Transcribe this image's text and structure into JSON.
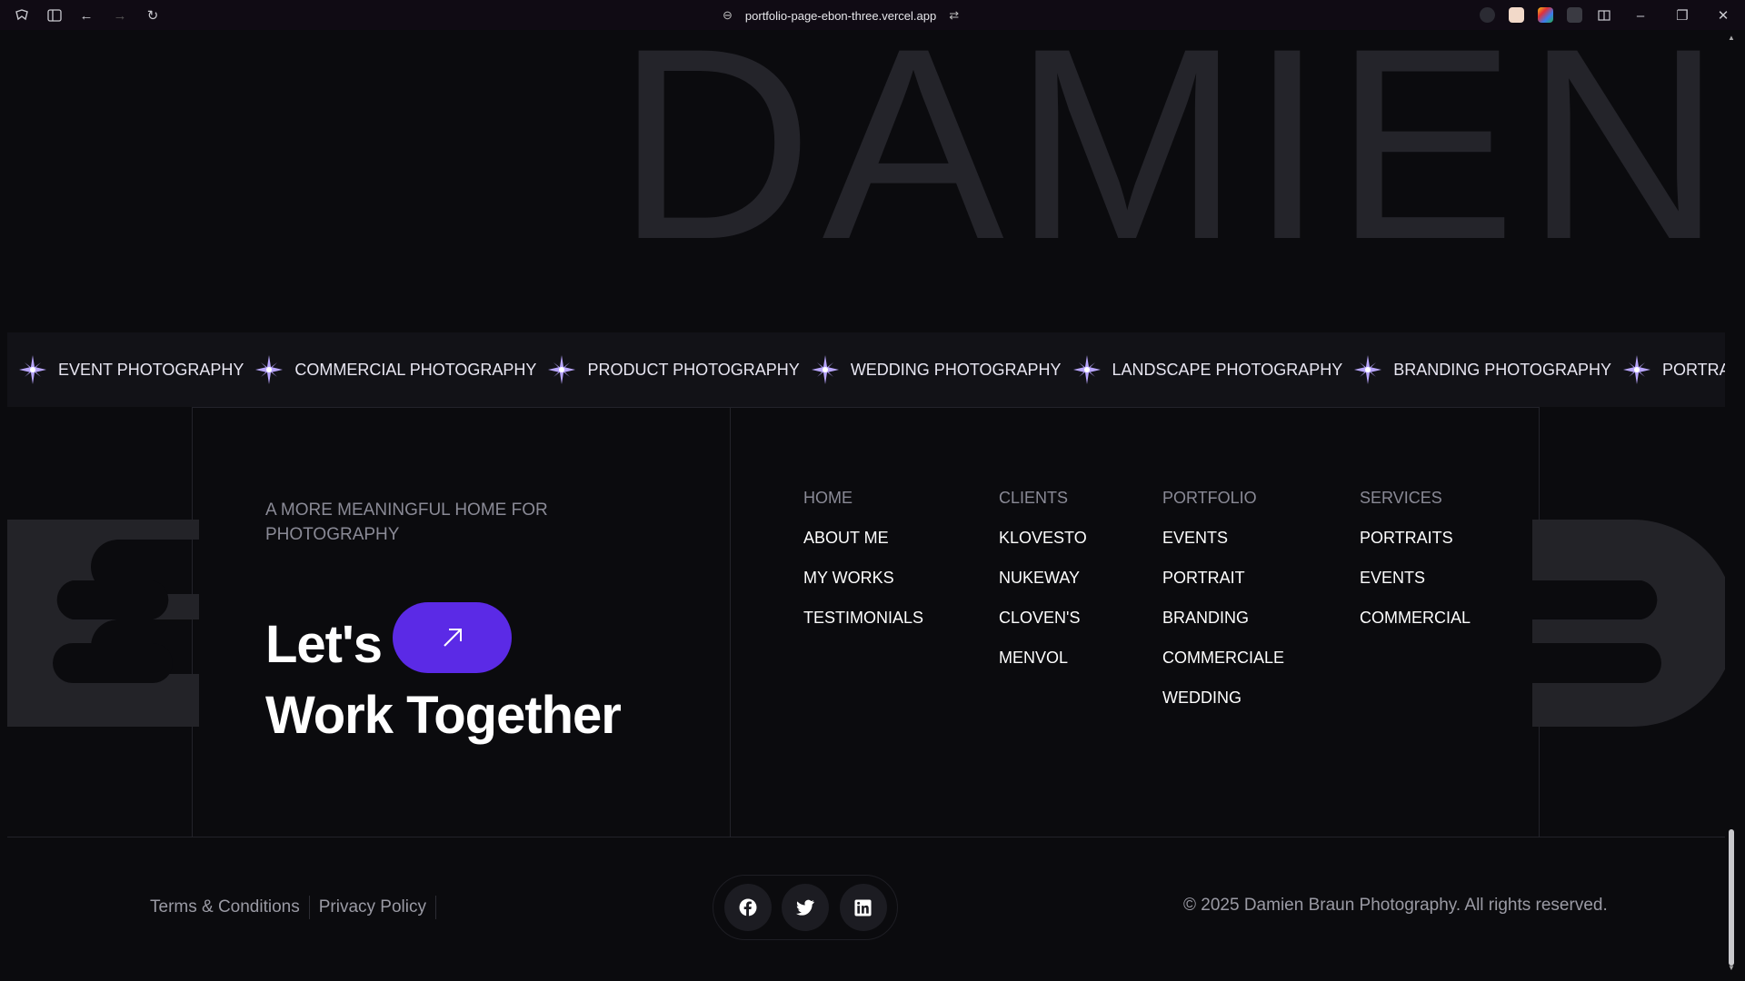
{
  "browser": {
    "url": "portfolio-page-ebon-three.vercel.app"
  },
  "hero": {
    "big_name": "DAMIEN"
  },
  "marquee": {
    "items": [
      "EVENT PHOTOGRAPHY",
      "COMMERCIAL PHOTOGRAPHY",
      "PRODUCT PHOTOGRAPHY",
      "WEDDING PHOTOGRAPHY",
      "LANDSCAPE PHOTOGRAPHY",
      "BRANDING PHOTOGRAPHY",
      "PORTRAIT PHOTOGRAPHY"
    ],
    "star_color": "#b9a6ff"
  },
  "footer": {
    "tagline": "A MORE MEANINGFUL HOME FOR PHOTOGRAPHY",
    "cta_line1": "Let's",
    "cta_line2": "Work Together",
    "cta_button_color": "#5b2ae6",
    "columns": [
      {
        "head": "HOME",
        "links": [
          "ABOUT ME",
          "MY WORKS",
          "TESTIMONIALS"
        ]
      },
      {
        "head": "CLIENTS",
        "links": [
          "KLOVESTO",
          "NUKEWAY",
          "CLOVEN'S",
          "MENVOL"
        ]
      },
      {
        "head": "PORTFOLIO",
        "links": [
          "EVENTS",
          "PORTRAIT",
          "BRANDING",
          "COMMERCIALE",
          "WEDDING"
        ]
      },
      {
        "head": "SERVICES",
        "links": [
          "PORTRAITS",
          "EVENTS",
          "COMMERCIAL"
        ]
      }
    ]
  },
  "bottom": {
    "terms": "Terms & Conditions",
    "privacy": "Privacy Policy",
    "social": [
      "facebook-icon",
      "twitter-icon",
      "linkedin-icon"
    ],
    "copyright": "© 2025 Damien Braun Photography. All rights reserved."
  }
}
